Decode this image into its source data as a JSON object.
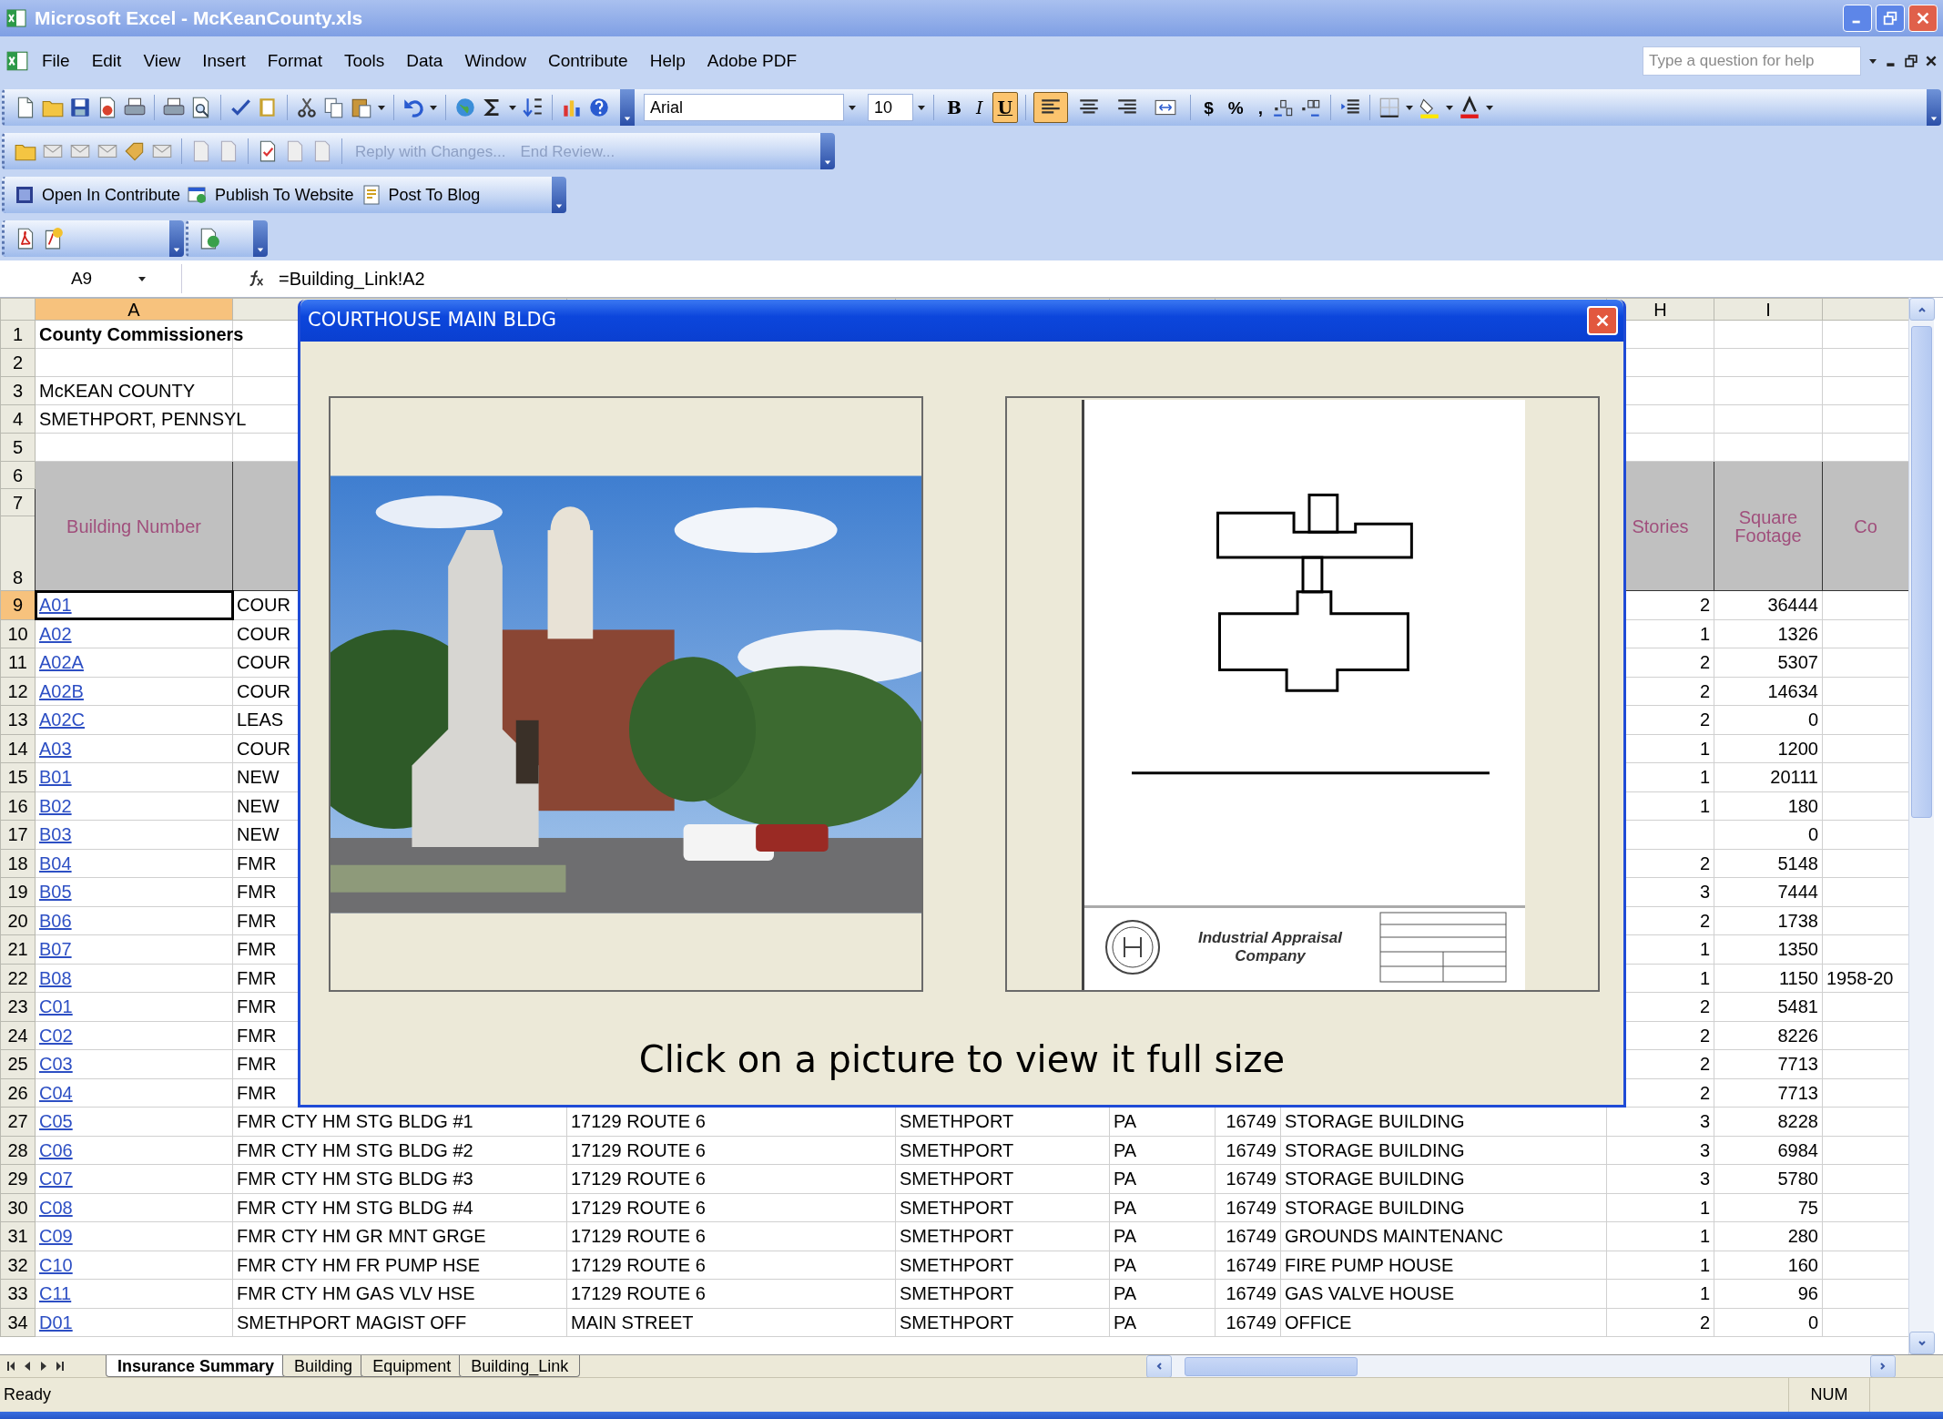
{
  "window": {
    "title": "Microsoft Excel - McKeanCounty.xls"
  },
  "menu": [
    "File",
    "Edit",
    "View",
    "Insert",
    "Format",
    "Tools",
    "Data",
    "Window",
    "Contribute",
    "Help",
    "Adobe PDF"
  ],
  "help_box": {
    "placeholder": "Type a question for help"
  },
  "formatting_toolbar": {
    "font": "Arial",
    "size": "10",
    "style_buttons": [
      {
        "label": "B",
        "selected": false
      },
      {
        "label": "I",
        "selected": false
      },
      {
        "label": "U",
        "selected": true
      }
    ],
    "alignment": [
      {
        "selected": true
      },
      {
        "selected": false
      },
      {
        "selected": false
      },
      {
        "selected": false
      }
    ],
    "number_buttons": [
      "$",
      "%",
      ","
    ]
  },
  "review_toolbar": [
    {
      "label": "Reply with Changes...",
      "disabled": true
    },
    {
      "label": "End Review...",
      "disabled": true
    }
  ],
  "contribute_toolbar": [
    "Open In Contribute",
    "Publish To Website",
    "Post To Blog"
  ],
  "formula_bar": {
    "name_box": "A9",
    "formula": "=Building_Link!A2"
  },
  "sheet": {
    "column_headers": [
      {
        "label": "A",
        "selected": true
      },
      {
        "label": "H",
        "selected": false
      },
      {
        "label": "I",
        "selected": false
      }
    ],
    "rows": [
      {
        "number": "1",
        "kind": "title",
        "selected": false,
        "cells": {
          "A": "County Commissioners"
        }
      },
      {
        "number": "2",
        "kind": "text",
        "selected": false
      },
      {
        "number": "3",
        "kind": "text",
        "selected": false,
        "cells": {
          "A": "McKEAN COUNTY"
        }
      },
      {
        "number": "4",
        "kind": "text",
        "selected": false,
        "cells": {
          "A": "SMETHPORT, PENNSYL"
        }
      },
      {
        "number": "5",
        "kind": "text",
        "selected": false
      },
      {
        "numbers": [
          "6",
          "7",
          "8"
        ],
        "kind": "header",
        "selected": false,
        "cells": {
          "A": "Building Number",
          "H": "Stories",
          "I": "Square Footage",
          "J": "Co"
        }
      },
      {
        "number": "9",
        "kind": "record",
        "selected": true,
        "cells": {
          "A": "A01",
          "B": "COUR",
          "H": "2",
          "I": "36444"
        }
      },
      {
        "number": "10",
        "kind": "record",
        "selected": false,
        "cells": {
          "A": "A02",
          "B": "COUR",
          "H": "1",
          "I": "1326"
        }
      },
      {
        "number": "11",
        "kind": "record",
        "selected": false,
        "cells": {
          "A": "A02A",
          "B": "COUR",
          "H": "2",
          "I": "5307"
        }
      },
      {
        "number": "12",
        "kind": "record",
        "selected": false,
        "cells": {
          "A": "A02B",
          "B": "COUR",
          "H": "2",
          "I": "14634"
        }
      },
      {
        "number": "13",
        "kind": "record",
        "selected": false,
        "cells": {
          "A": "A02C",
          "B": "LEAS",
          "H": "2",
          "I": "0"
        }
      },
      {
        "number": "14",
        "kind": "record",
        "selected": false,
        "cells": {
          "A": "A03",
          "B": "COUR",
          "H": "1",
          "I": "1200"
        }
      },
      {
        "number": "15",
        "kind": "record",
        "selected": false,
        "cells": {
          "A": "B01",
          "B": "NEW",
          "H": "1",
          "I": "20111"
        }
      },
      {
        "number": "16",
        "kind": "record",
        "selected": false,
        "cells": {
          "A": "B02",
          "B": "NEW",
          "H": "1",
          "I": "180"
        }
      },
      {
        "number": "17",
        "kind": "record",
        "selected": false,
        "cells": {
          "A": "B03",
          "B": "NEW",
          "I": "0"
        }
      },
      {
        "number": "18",
        "kind": "record",
        "selected": false,
        "cells": {
          "A": "B04",
          "B": "FMR",
          "H": "2",
          "I": "5148"
        }
      },
      {
        "number": "19",
        "kind": "record",
        "selected": false,
        "cells": {
          "A": "B05",
          "B": "FMR",
          "H": "3",
          "I": "7444"
        }
      },
      {
        "number": "20",
        "kind": "record",
        "selected": false,
        "cells": {
          "A": "B06",
          "B": "FMR",
          "H": "2",
          "I": "1738"
        }
      },
      {
        "number": "21",
        "kind": "record",
        "selected": false,
        "cells": {
          "A": "B07",
          "B": "FMR",
          "H": "1",
          "I": "1350"
        }
      },
      {
        "number": "22",
        "kind": "record",
        "selected": false,
        "cells": {
          "A": "B08",
          "B": "FMR",
          "H": "1",
          "I": "1150",
          "J": "1958-20"
        }
      },
      {
        "number": "23",
        "kind": "record",
        "selected": false,
        "cells": {
          "A": "C01",
          "B": "FMR",
          "H": "2",
          "I": "5481"
        }
      },
      {
        "number": "24",
        "kind": "record",
        "selected": false,
        "cells": {
          "A": "C02",
          "B": "FMR",
          "H": "2",
          "I": "8226"
        }
      },
      {
        "number": "25",
        "kind": "record",
        "selected": false,
        "cells": {
          "A": "C03",
          "B": "FMR",
          "H": "2",
          "I": "7713"
        }
      },
      {
        "number": "26",
        "kind": "record",
        "selected": false,
        "cells": {
          "A": "C04",
          "B": "FMR",
          "H": "2",
          "I": "7713"
        }
      },
      {
        "number": "27",
        "kind": "record",
        "selected": false,
        "cells": {
          "A": "C05",
          "B": "FMR CTY HM STG BLDG #1",
          "C": "17129 ROUTE 6",
          "D": "SMETHPORT",
          "E": "PA",
          "F": "16749",
          "G": "STORAGE BUILDING",
          "H": "3",
          "I": "8228"
        }
      },
      {
        "number": "28",
        "kind": "record",
        "selected": false,
        "cells": {
          "A": "C06",
          "B": "FMR CTY HM STG BLDG #2",
          "C": "17129 ROUTE 6",
          "D": "SMETHPORT",
          "E": "PA",
          "F": "16749",
          "G": "STORAGE BUILDING",
          "H": "3",
          "I": "6984"
        }
      },
      {
        "number": "29",
        "kind": "record",
        "selected": false,
        "cells": {
          "A": "C07",
          "B": "FMR CTY HM STG BLDG #3",
          "C": "17129 ROUTE 6",
          "D": "SMETHPORT",
          "E": "PA",
          "F": "16749",
          "G": "STORAGE BUILDING",
          "H": "3",
          "I": "5780"
        }
      },
      {
        "number": "30",
        "kind": "record",
        "selected": false,
        "cells": {
          "A": "C08",
          "B": "FMR CTY HM STG BLDG #4",
          "C": "17129 ROUTE 6",
          "D": "SMETHPORT",
          "E": "PA",
          "F": "16749",
          "G": "STORAGE BUILDING",
          "H": "1",
          "I": "75"
        }
      },
      {
        "number": "31",
        "kind": "record",
        "selected": false,
        "cells": {
          "A": "C09",
          "B": "FMR CTY HM GR MNT GRGE",
          "C": "17129 ROUTE 6",
          "D": "SMETHPORT",
          "E": "PA",
          "F": "16749",
          "G": "GROUNDS MAINTENANC",
          "H": "1",
          "I": "280"
        }
      },
      {
        "number": "32",
        "kind": "record",
        "selected": false,
        "cells": {
          "A": "C10",
          "B": "FMR CTY HM FR PUMP HSE",
          "C": "17129 ROUTE 6",
          "D": "SMETHPORT",
          "E": "PA",
          "F": "16749",
          "G": "FIRE PUMP HOUSE",
          "H": "1",
          "I": "160"
        }
      },
      {
        "number": "33",
        "kind": "record",
        "selected": false,
        "cells": {
          "A": "C11",
          "B": "FMR CTY HM GAS VLV HSE",
          "C": "17129 ROUTE 6",
          "D": "SMETHPORT",
          "E": "PA",
          "F": "16749",
          "G": "GAS VALVE HOUSE",
          "H": "1",
          "I": "96"
        }
      },
      {
        "number": "34",
        "kind": "record",
        "selected": false,
        "cells": {
          "A": "D01",
          "B": "SMETHPORT MAGIST OFF",
          "C": "MAIN STREET",
          "D": "SMETHPORT",
          "E": "PA",
          "F": "16749",
          "G": "OFFICE",
          "H": "2",
          "I": "0"
        }
      }
    ]
  },
  "dialog": {
    "title": "COURTHOUSE MAIN BLDG",
    "caption": "Click on a picture to view it full size",
    "drawing": {
      "company": "Industrial Appraisal Company"
    }
  },
  "sheet_tabs": [
    {
      "label": "Insurance Summary",
      "selected": true
    },
    {
      "label": "Building",
      "selected": false
    },
    {
      "label": "Equipment",
      "selected": false
    },
    {
      "label": "Building_Link",
      "selected": false
    }
  ],
  "status_bar": {
    "message": "Ready",
    "indicator": "NUM"
  }
}
